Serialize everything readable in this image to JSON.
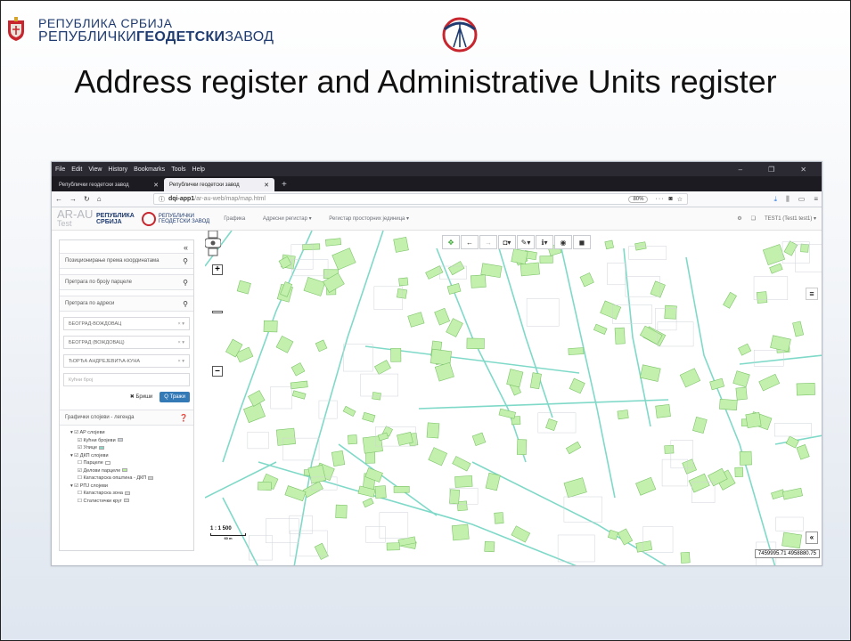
{
  "slide": {
    "org_line1": "РЕПУБЛИКА СРБИЈА",
    "org_line2_a": "РЕПУБЛИЧКИ",
    "org_line2_b": "ГЕОДЕТСКИ",
    "org_line2_c": "ЗАВОД",
    "title": "Address register and Administrative Units register"
  },
  "browser": {
    "menu": [
      "File",
      "Edit",
      "View",
      "History",
      "Bookmarks",
      "Tools",
      "Help"
    ],
    "tabs": [
      {
        "label": "Републички геодетски завод",
        "active": false
      },
      {
        "label": "Републички геодетски завод",
        "active": true
      }
    ],
    "url_host": "dqi-app1",
    "url_path": "/ar-au-web/map/map.html",
    "zoom": "80%"
  },
  "app": {
    "name": "AR-AU",
    "env": "Test",
    "logo_rs": [
      "РЕПУБЛИКА",
      "СРБИЈА"
    ],
    "logo_rgz": [
      "РЕПУБЛИЧКИ",
      "ГЕОДЕТСКИ ЗАВОД"
    ],
    "menu": [
      "Графика",
      "Адресни регистар ▾",
      "Регистар просторних јединица ▾"
    ],
    "user": "TEST1 (Test1 test1) ▾"
  },
  "sidebar": {
    "search_coords": "Позиционирање према координатама",
    "search_parcel": "Претрага по броју парцеле",
    "search_address": "Претрага по адреси",
    "fields": [
      "БЕОГРАД-ВОЖДОВАЦ",
      "БЕОГРАД (ВОЖДОВАЦ)",
      "ЂОРЂА АНДРЕЈЕВИЋА-КУНА"
    ],
    "house_number_placeholder": "Кућни број",
    "btn_clear": "✖ Бриши",
    "btn_search": "Q Тражи",
    "legend_title": "Графички слојеви - легенда",
    "legend": [
      {
        "label": "AP слојеви",
        "level": 1,
        "checked": true,
        "expand": true
      },
      {
        "label": "Кућни бројеви",
        "level": 2,
        "checked": true,
        "swatch": "#c9d0dc"
      },
      {
        "label": "Улице",
        "level": 2,
        "checked": true,
        "swatch": "#8fd6c6"
      },
      {
        "label": "ДКП слојеви",
        "level": 1,
        "checked": true,
        "expand": true
      },
      {
        "label": "Парцеле",
        "level": 2,
        "checked": false,
        "swatch": "#ffffff"
      },
      {
        "label": "Делови парцеле",
        "level": 2,
        "checked": true,
        "swatch": "#b9f0a0"
      },
      {
        "label": "Катастарска општина - ДКП",
        "level": 2,
        "checked": false,
        "swatch": "#d0d0d0"
      },
      {
        "label": "РПЈ слојеви",
        "level": 1,
        "checked": true,
        "expand": true
      },
      {
        "label": "Катастарска зона",
        "level": 2,
        "checked": false,
        "swatch": "#dddddd"
      },
      {
        "label": "Статистички круг",
        "level": 2,
        "checked": false,
        "swatch": "#dddddd"
      }
    ]
  },
  "map": {
    "scale": "1 : 1 500",
    "scale_unit": "60 m",
    "coordinates": "7459995.71 4958880.75",
    "colors": {
      "building": "#c4f0ad",
      "building_stroke": "#7cc46a",
      "street": "#7fd9c8"
    }
  }
}
